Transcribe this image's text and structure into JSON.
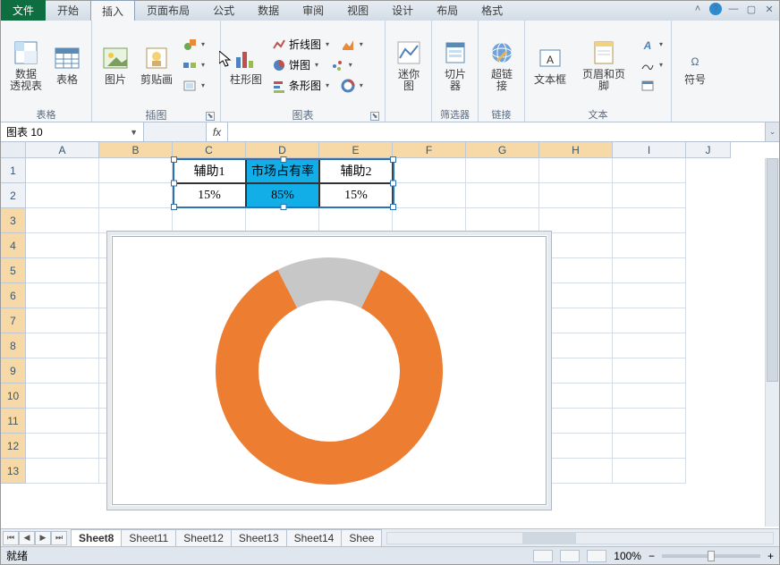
{
  "tabs": {
    "file": "文件",
    "items": [
      "开始",
      "插入",
      "页面布局",
      "公式",
      "数据",
      "审阅",
      "视图",
      "设计",
      "布局",
      "格式"
    ],
    "active": "插入"
  },
  "ribbon": {
    "tables": {
      "pivot": "数据\n透视表",
      "table": "表格",
      "group": "表格"
    },
    "illus": {
      "picture": "图片",
      "clipart": "剪贴画",
      "group": "插图"
    },
    "charts": {
      "column": "柱形图",
      "line": "折线图",
      "pie": "饼图",
      "bar": "条形图",
      "group": "图表"
    },
    "spark": {
      "btn": "迷你图",
      "group": ""
    },
    "filter": {
      "slicer": "切片器",
      "group": "筛选器"
    },
    "links": {
      "hyper": "超链接",
      "group": "链接"
    },
    "text": {
      "textbox": "文本框",
      "header": "页眉和页脚",
      "group": "文本"
    },
    "symbols": {
      "sym": "符号",
      "group": ""
    }
  },
  "namebox": "图表 10",
  "columns": [
    "A",
    "B",
    "C",
    "D",
    "E",
    "F",
    "G",
    "H",
    "I",
    "J"
  ],
  "rows": [
    "1",
    "2",
    "3",
    "4",
    "5",
    "6",
    "7",
    "8",
    "9",
    "10",
    "11",
    "12",
    "13"
  ],
  "data": {
    "headers": [
      "辅助1",
      "市场占有率",
      "辅助2"
    ],
    "values": [
      "15%",
      "85%",
      "15%"
    ]
  },
  "chart_data": {
    "type": "pie",
    "title": "",
    "series": [
      {
        "name": "市场占有率",
        "values": [
          15,
          85,
          15
        ],
        "categories": [
          "辅助1",
          "市场占有率",
          "辅助2"
        ]
      }
    ],
    "style": "donut",
    "colors": [
      "#c7c7c7",
      "#ed7d31",
      "#c7c7c7"
    ]
  },
  "sheets": {
    "items": [
      "Sheet8",
      "Sheet11",
      "Sheet12",
      "Sheet13",
      "Sheet14",
      "Shee"
    ],
    "active": "Sheet8"
  },
  "status": {
    "ready": "就绪",
    "zoom": "100%"
  }
}
